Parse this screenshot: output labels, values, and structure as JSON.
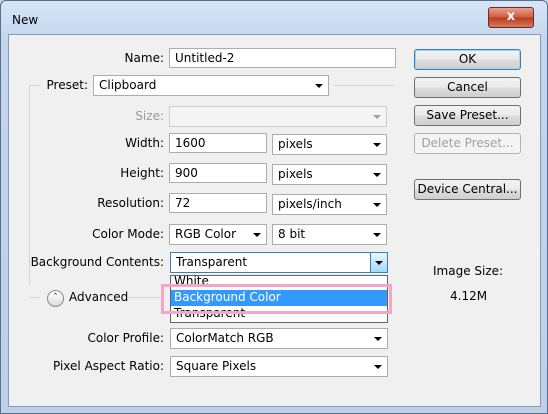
{
  "window": {
    "title": "New",
    "close_glyph": "x"
  },
  "form": {
    "name_label": "Name:",
    "name_value": "Untitled-2",
    "preset_label": "Preset:",
    "preset_value": "Clipboard",
    "size_label": "Size:",
    "size_value": "",
    "width_label": "Width:",
    "width_value": "1600",
    "width_unit": "pixels",
    "height_label": "Height:",
    "height_value": "900",
    "height_unit": "pixels",
    "resolution_label": "Resolution:",
    "resolution_value": "72",
    "resolution_unit": "pixels/inch",
    "color_mode_label": "Color Mode:",
    "color_mode_value": "RGB Color",
    "bit_depth_value": "8 bit",
    "bg_label": "Background Contents:",
    "bg_value": "Transparent",
    "advanced_label": "Advanced",
    "color_profile_label": "Color Profile:",
    "color_profile_value": "ColorMatch RGB",
    "pixel_aspect_label": "Pixel Aspect Ratio:",
    "pixel_aspect_value": "Square Pixels"
  },
  "bg_options": [
    {
      "label": "White",
      "selected": false
    },
    {
      "label": "Background Color",
      "selected": true
    },
    {
      "label": "Transparent",
      "selected": false
    }
  ],
  "buttons": {
    "ok": "OK",
    "cancel": "Cancel",
    "save_preset": "Save Preset...",
    "delete_preset": "Delete Preset...",
    "device_central": "Device Central..."
  },
  "image_size": {
    "label": "Image Size:",
    "value": "4.12M"
  },
  "colors": {
    "selection": "#3399ff",
    "highlight": "#f4a6c7"
  },
  "icons": {
    "advanced_toggle": "double-chevron-up-icon",
    "dropdown": "chevron-down-icon",
    "close": "close-icon"
  }
}
